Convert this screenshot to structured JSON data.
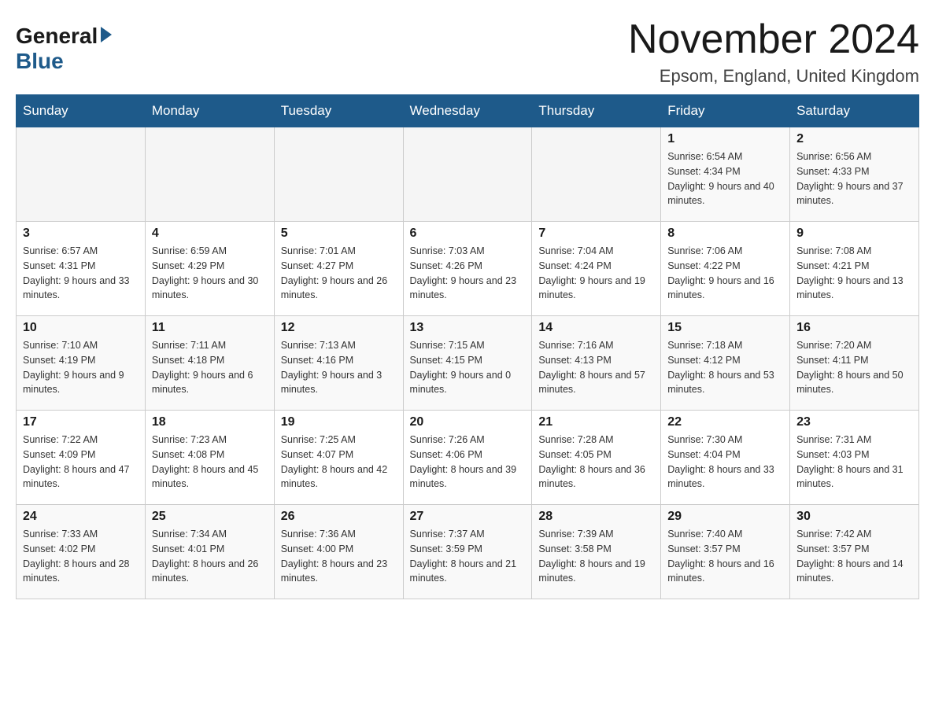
{
  "header": {
    "logo_general": "General",
    "logo_blue": "Blue",
    "title": "November 2024",
    "location": "Epsom, England, United Kingdom"
  },
  "weekdays": [
    "Sunday",
    "Monday",
    "Tuesday",
    "Wednesday",
    "Thursday",
    "Friday",
    "Saturday"
  ],
  "weeks": [
    {
      "days": [
        {
          "num": "",
          "info": ""
        },
        {
          "num": "",
          "info": ""
        },
        {
          "num": "",
          "info": ""
        },
        {
          "num": "",
          "info": ""
        },
        {
          "num": "",
          "info": ""
        },
        {
          "num": "1",
          "info": "Sunrise: 6:54 AM\nSunset: 4:34 PM\nDaylight: 9 hours and 40 minutes."
        },
        {
          "num": "2",
          "info": "Sunrise: 6:56 AM\nSunset: 4:33 PM\nDaylight: 9 hours and 37 minutes."
        }
      ]
    },
    {
      "days": [
        {
          "num": "3",
          "info": "Sunrise: 6:57 AM\nSunset: 4:31 PM\nDaylight: 9 hours and 33 minutes."
        },
        {
          "num": "4",
          "info": "Sunrise: 6:59 AM\nSunset: 4:29 PM\nDaylight: 9 hours and 30 minutes."
        },
        {
          "num": "5",
          "info": "Sunrise: 7:01 AM\nSunset: 4:27 PM\nDaylight: 9 hours and 26 minutes."
        },
        {
          "num": "6",
          "info": "Sunrise: 7:03 AM\nSunset: 4:26 PM\nDaylight: 9 hours and 23 minutes."
        },
        {
          "num": "7",
          "info": "Sunrise: 7:04 AM\nSunset: 4:24 PM\nDaylight: 9 hours and 19 minutes."
        },
        {
          "num": "8",
          "info": "Sunrise: 7:06 AM\nSunset: 4:22 PM\nDaylight: 9 hours and 16 minutes."
        },
        {
          "num": "9",
          "info": "Sunrise: 7:08 AM\nSunset: 4:21 PM\nDaylight: 9 hours and 13 minutes."
        }
      ]
    },
    {
      "days": [
        {
          "num": "10",
          "info": "Sunrise: 7:10 AM\nSunset: 4:19 PM\nDaylight: 9 hours and 9 minutes."
        },
        {
          "num": "11",
          "info": "Sunrise: 7:11 AM\nSunset: 4:18 PM\nDaylight: 9 hours and 6 minutes."
        },
        {
          "num": "12",
          "info": "Sunrise: 7:13 AM\nSunset: 4:16 PM\nDaylight: 9 hours and 3 minutes."
        },
        {
          "num": "13",
          "info": "Sunrise: 7:15 AM\nSunset: 4:15 PM\nDaylight: 9 hours and 0 minutes."
        },
        {
          "num": "14",
          "info": "Sunrise: 7:16 AM\nSunset: 4:13 PM\nDaylight: 8 hours and 57 minutes."
        },
        {
          "num": "15",
          "info": "Sunrise: 7:18 AM\nSunset: 4:12 PM\nDaylight: 8 hours and 53 minutes."
        },
        {
          "num": "16",
          "info": "Sunrise: 7:20 AM\nSunset: 4:11 PM\nDaylight: 8 hours and 50 minutes."
        }
      ]
    },
    {
      "days": [
        {
          "num": "17",
          "info": "Sunrise: 7:22 AM\nSunset: 4:09 PM\nDaylight: 8 hours and 47 minutes."
        },
        {
          "num": "18",
          "info": "Sunrise: 7:23 AM\nSunset: 4:08 PM\nDaylight: 8 hours and 45 minutes."
        },
        {
          "num": "19",
          "info": "Sunrise: 7:25 AM\nSunset: 4:07 PM\nDaylight: 8 hours and 42 minutes."
        },
        {
          "num": "20",
          "info": "Sunrise: 7:26 AM\nSunset: 4:06 PM\nDaylight: 8 hours and 39 minutes."
        },
        {
          "num": "21",
          "info": "Sunrise: 7:28 AM\nSunset: 4:05 PM\nDaylight: 8 hours and 36 minutes."
        },
        {
          "num": "22",
          "info": "Sunrise: 7:30 AM\nSunset: 4:04 PM\nDaylight: 8 hours and 33 minutes."
        },
        {
          "num": "23",
          "info": "Sunrise: 7:31 AM\nSunset: 4:03 PM\nDaylight: 8 hours and 31 minutes."
        }
      ]
    },
    {
      "days": [
        {
          "num": "24",
          "info": "Sunrise: 7:33 AM\nSunset: 4:02 PM\nDaylight: 8 hours and 28 minutes."
        },
        {
          "num": "25",
          "info": "Sunrise: 7:34 AM\nSunset: 4:01 PM\nDaylight: 8 hours and 26 minutes."
        },
        {
          "num": "26",
          "info": "Sunrise: 7:36 AM\nSunset: 4:00 PM\nDaylight: 8 hours and 23 minutes."
        },
        {
          "num": "27",
          "info": "Sunrise: 7:37 AM\nSunset: 3:59 PM\nDaylight: 8 hours and 21 minutes."
        },
        {
          "num": "28",
          "info": "Sunrise: 7:39 AM\nSunset: 3:58 PM\nDaylight: 8 hours and 19 minutes."
        },
        {
          "num": "29",
          "info": "Sunrise: 7:40 AM\nSunset: 3:57 PM\nDaylight: 8 hours and 16 minutes."
        },
        {
          "num": "30",
          "info": "Sunrise: 7:42 AM\nSunset: 3:57 PM\nDaylight: 8 hours and 14 minutes."
        }
      ]
    }
  ]
}
